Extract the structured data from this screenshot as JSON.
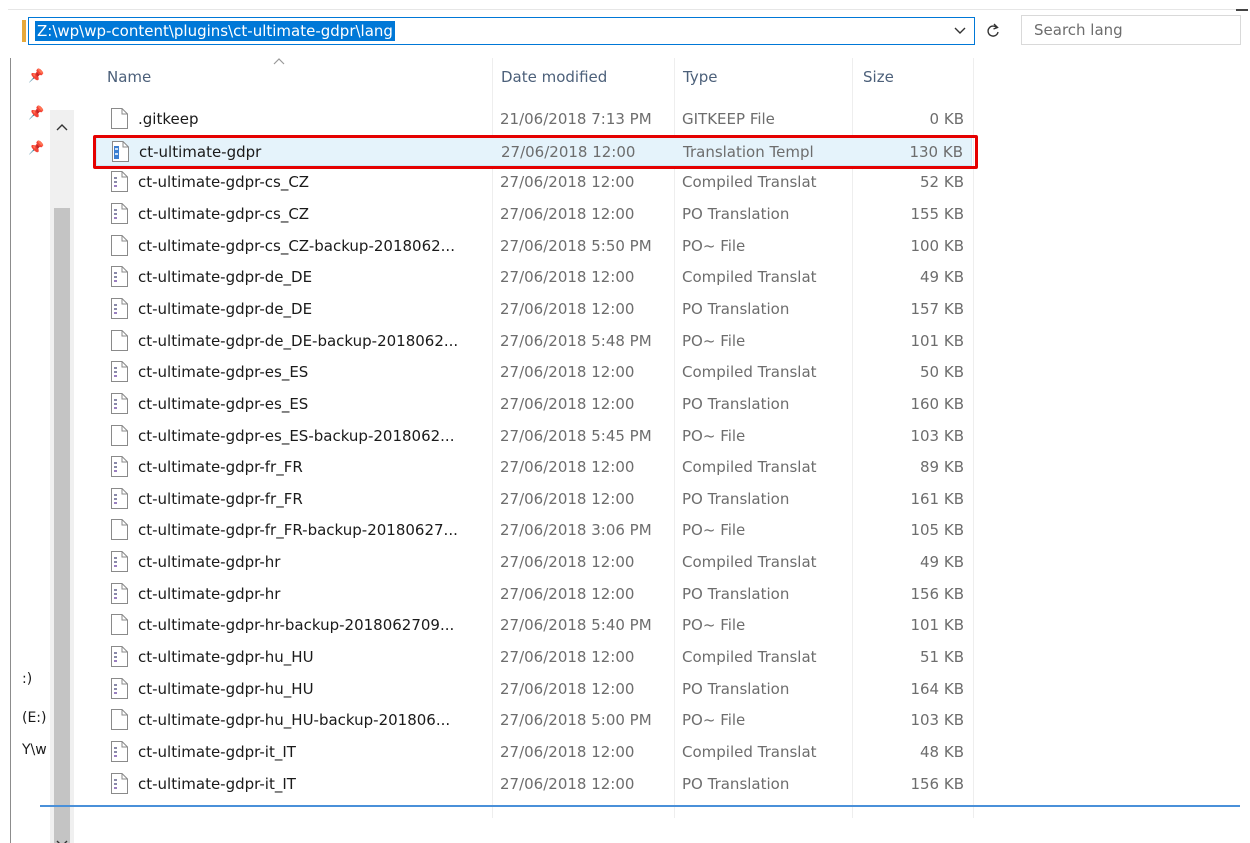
{
  "address": {
    "path": "Z:\\wp\\wp-content\\plugins\\ct-ultimate-gdpr\\lang"
  },
  "search": {
    "placeholder": "Search lang"
  },
  "nav": {
    "frag1": ":)",
    "frag2": "(E:)",
    "frag3": "Y\\w"
  },
  "columns": {
    "name": "Name",
    "date": "Date modified",
    "type": "Type",
    "size": "Size"
  },
  "selected_index": 1,
  "files": [
    {
      "name": ".gitkeep",
      "date": "21/06/2018 7:13 PM",
      "type": "GITKEEP File",
      "size": "0 KB",
      "icon": "blank-file-icon"
    },
    {
      "name": "ct-ultimate-gdpr",
      "date": "27/06/2018 12:00",
      "type": "Translation Templ",
      "size": "130 KB",
      "icon": "pot-file-icon"
    },
    {
      "name": "ct-ultimate-gdpr-cs_CZ",
      "date": "27/06/2018 12:00",
      "type": "Compiled Translat",
      "size": "52 KB",
      "icon": "translation-file-icon"
    },
    {
      "name": "ct-ultimate-gdpr-cs_CZ",
      "date": "27/06/2018 12:00",
      "type": "PO Translation",
      "size": "155 KB",
      "icon": "translation-file-icon"
    },
    {
      "name": "ct-ultimate-gdpr-cs_CZ-backup-2018062...",
      "date": "27/06/2018 5:50 PM",
      "type": "PO~ File",
      "size": "100 KB",
      "icon": "blank-file-icon"
    },
    {
      "name": "ct-ultimate-gdpr-de_DE",
      "date": "27/06/2018 12:00",
      "type": "Compiled Translat",
      "size": "49 KB",
      "icon": "translation-file-icon"
    },
    {
      "name": "ct-ultimate-gdpr-de_DE",
      "date": "27/06/2018 12:00",
      "type": "PO Translation",
      "size": "157 KB",
      "icon": "translation-file-icon"
    },
    {
      "name": "ct-ultimate-gdpr-de_DE-backup-2018062...",
      "date": "27/06/2018 5:48 PM",
      "type": "PO~ File",
      "size": "101 KB",
      "icon": "blank-file-icon"
    },
    {
      "name": "ct-ultimate-gdpr-es_ES",
      "date": "27/06/2018 12:00",
      "type": "Compiled Translat",
      "size": "50 KB",
      "icon": "translation-file-icon"
    },
    {
      "name": "ct-ultimate-gdpr-es_ES",
      "date": "27/06/2018 12:00",
      "type": "PO Translation",
      "size": "160 KB",
      "icon": "translation-file-icon"
    },
    {
      "name": "ct-ultimate-gdpr-es_ES-backup-2018062...",
      "date": "27/06/2018 5:45 PM",
      "type": "PO~ File",
      "size": "103 KB",
      "icon": "blank-file-icon"
    },
    {
      "name": "ct-ultimate-gdpr-fr_FR",
      "date": "27/06/2018 12:00",
      "type": "Compiled Translat",
      "size": "89 KB",
      "icon": "translation-file-icon"
    },
    {
      "name": "ct-ultimate-gdpr-fr_FR",
      "date": "27/06/2018 12:00",
      "type": "PO Translation",
      "size": "161 KB",
      "icon": "translation-file-icon"
    },
    {
      "name": "ct-ultimate-gdpr-fr_FR-backup-20180627...",
      "date": "27/06/2018 3:06 PM",
      "type": "PO~ File",
      "size": "105 KB",
      "icon": "blank-file-icon"
    },
    {
      "name": "ct-ultimate-gdpr-hr",
      "date": "27/06/2018 12:00",
      "type": "Compiled Translat",
      "size": "49 KB",
      "icon": "translation-file-icon"
    },
    {
      "name": "ct-ultimate-gdpr-hr",
      "date": "27/06/2018 12:00",
      "type": "PO Translation",
      "size": "156 KB",
      "icon": "translation-file-icon"
    },
    {
      "name": "ct-ultimate-gdpr-hr-backup-2018062709...",
      "date": "27/06/2018 5:40 PM",
      "type": "PO~ File",
      "size": "101 KB",
      "icon": "blank-file-icon"
    },
    {
      "name": "ct-ultimate-gdpr-hu_HU",
      "date": "27/06/2018 12:00",
      "type": "Compiled Translat",
      "size": "51 KB",
      "icon": "translation-file-icon"
    },
    {
      "name": "ct-ultimate-gdpr-hu_HU",
      "date": "27/06/2018 12:00",
      "type": "PO Translation",
      "size": "164 KB",
      "icon": "translation-file-icon"
    },
    {
      "name": "ct-ultimate-gdpr-hu_HU-backup-201806...",
      "date": "27/06/2018 5:00 PM",
      "type": "PO~ File",
      "size": "103 KB",
      "icon": "blank-file-icon"
    },
    {
      "name": "ct-ultimate-gdpr-it_IT",
      "date": "27/06/2018 12:00",
      "type": "Compiled Translat",
      "size": "48 KB",
      "icon": "translation-file-icon"
    },
    {
      "name": "ct-ultimate-gdpr-it_IT",
      "date": "27/06/2018 12:00",
      "type": "PO Translation",
      "size": "156 KB",
      "icon": "translation-file-icon"
    }
  ],
  "colors": {
    "accent": "#0078d7",
    "selection": "#e5f3fb",
    "highlight": "#e50000",
    "header_text": "#4c607a"
  }
}
